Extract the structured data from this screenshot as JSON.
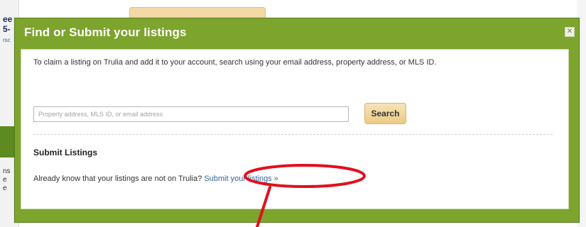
{
  "background": {
    "left_text": "ee\n5-",
    "left_small": "rsc",
    "left_bottom": "ns\ne\ne"
  },
  "modal": {
    "title": "Find or Submit your listings",
    "close_glyph": "✕",
    "intro": "To claim a listing on Trulia and add it to your account, search using your email address, property address, or MLS ID.",
    "search": {
      "placeholder": "Property address, MLS ID, or email address",
      "button_label": "Search"
    },
    "submit_section": {
      "title": "Submit Listings",
      "prefix": "Already know that your listings are not on Trulia?",
      "link_text": "Submit your listings »"
    }
  },
  "colors": {
    "header_green": "#7da42d",
    "link_blue": "#336699",
    "button_gold": "#eccb84",
    "annotation_red": "#e0101e"
  }
}
